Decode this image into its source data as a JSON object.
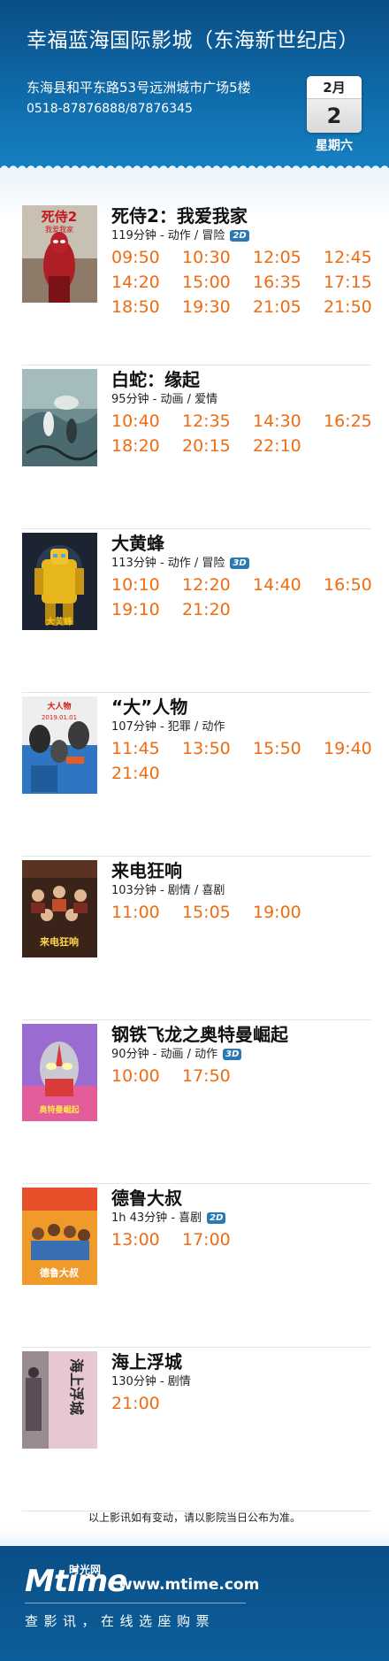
{
  "header": {
    "cinema_name": "幸福蓝海国际影城（东海新世纪店）",
    "address": "东海县和平东路53号远洲城市广场5楼",
    "phone": "0518-87876888/87876345",
    "month": "2月",
    "day": "2",
    "weekday": "星期六"
  },
  "films": [
    {
      "title": "死侍2：我爱我家",
      "meta": "119分钟 - 动作 / 冒险",
      "badge": "2D",
      "times": [
        "09:50",
        "10:30",
        "12:05",
        "12:45",
        "14:20",
        "15:00",
        "16:35",
        "17:15",
        "18:50",
        "19:30",
        "21:05",
        "21:50"
      ]
    },
    {
      "title": "白蛇：缘起",
      "meta": "95分钟 - 动画 / 爱情",
      "badge": "",
      "times": [
        "10:40",
        "12:35",
        "14:30",
        "16:25",
        "18:20",
        "20:15",
        "22:10"
      ]
    },
    {
      "title": "大黄蜂",
      "meta": "113分钟 - 动作 / 冒险",
      "badge": "3D",
      "times": [
        "10:10",
        "12:20",
        "14:40",
        "16:50",
        "19:10",
        "21:20"
      ]
    },
    {
      "title": "“大”人物",
      "meta": "107分钟 - 犯罪 / 动作",
      "badge": "",
      "times": [
        "11:45",
        "13:50",
        "15:50",
        "19:40",
        "21:40"
      ]
    },
    {
      "title": "来电狂响",
      "meta": "103分钟 - 剧情 / 喜剧",
      "badge": "",
      "times": [
        "11:00",
        "15:05",
        "19:00"
      ]
    },
    {
      "title": "钢铁飞龙之奥特曼崛起",
      "meta": "90分钟 - 动画 / 动作",
      "badge": "3D",
      "times": [
        "10:00",
        "17:50"
      ]
    },
    {
      "title": "德鲁大叔",
      "meta": "1h 43分钟 - 喜剧",
      "badge": "2D",
      "times": [
        "13:00",
        "17:00"
      ]
    },
    {
      "title": "海上浮城",
      "meta": "130分钟 - 剧情",
      "badge": "",
      "times": [
        "21:00"
      ]
    }
  ],
  "posters": {
    "0": {
      "text": "死侍2",
      "sub": "我爱我家"
    },
    "1": {
      "text": "",
      "sub": ""
    },
    "2": {
      "text": "大黄蜂",
      "sub": ""
    },
    "3": {
      "text": "大人物",
      "sub": "2019.01.01"
    },
    "4": {
      "text": "来电狂响",
      "sub": ""
    },
    "5": {
      "text": "奥特曼崛起",
      "sub": ""
    },
    "6": {
      "text": "德鲁大叔",
      "sub": ""
    },
    "7": {
      "text": "海上浮城",
      "sub": ""
    }
  },
  "notice": "以上影讯如有变动，请以影院当日公布为准。",
  "footer": {
    "logo_text": "Mtime",
    "logo_cn": "时光网",
    "url": "www.mtime.com",
    "slogan": "查影讯，在线选座购票"
  }
}
